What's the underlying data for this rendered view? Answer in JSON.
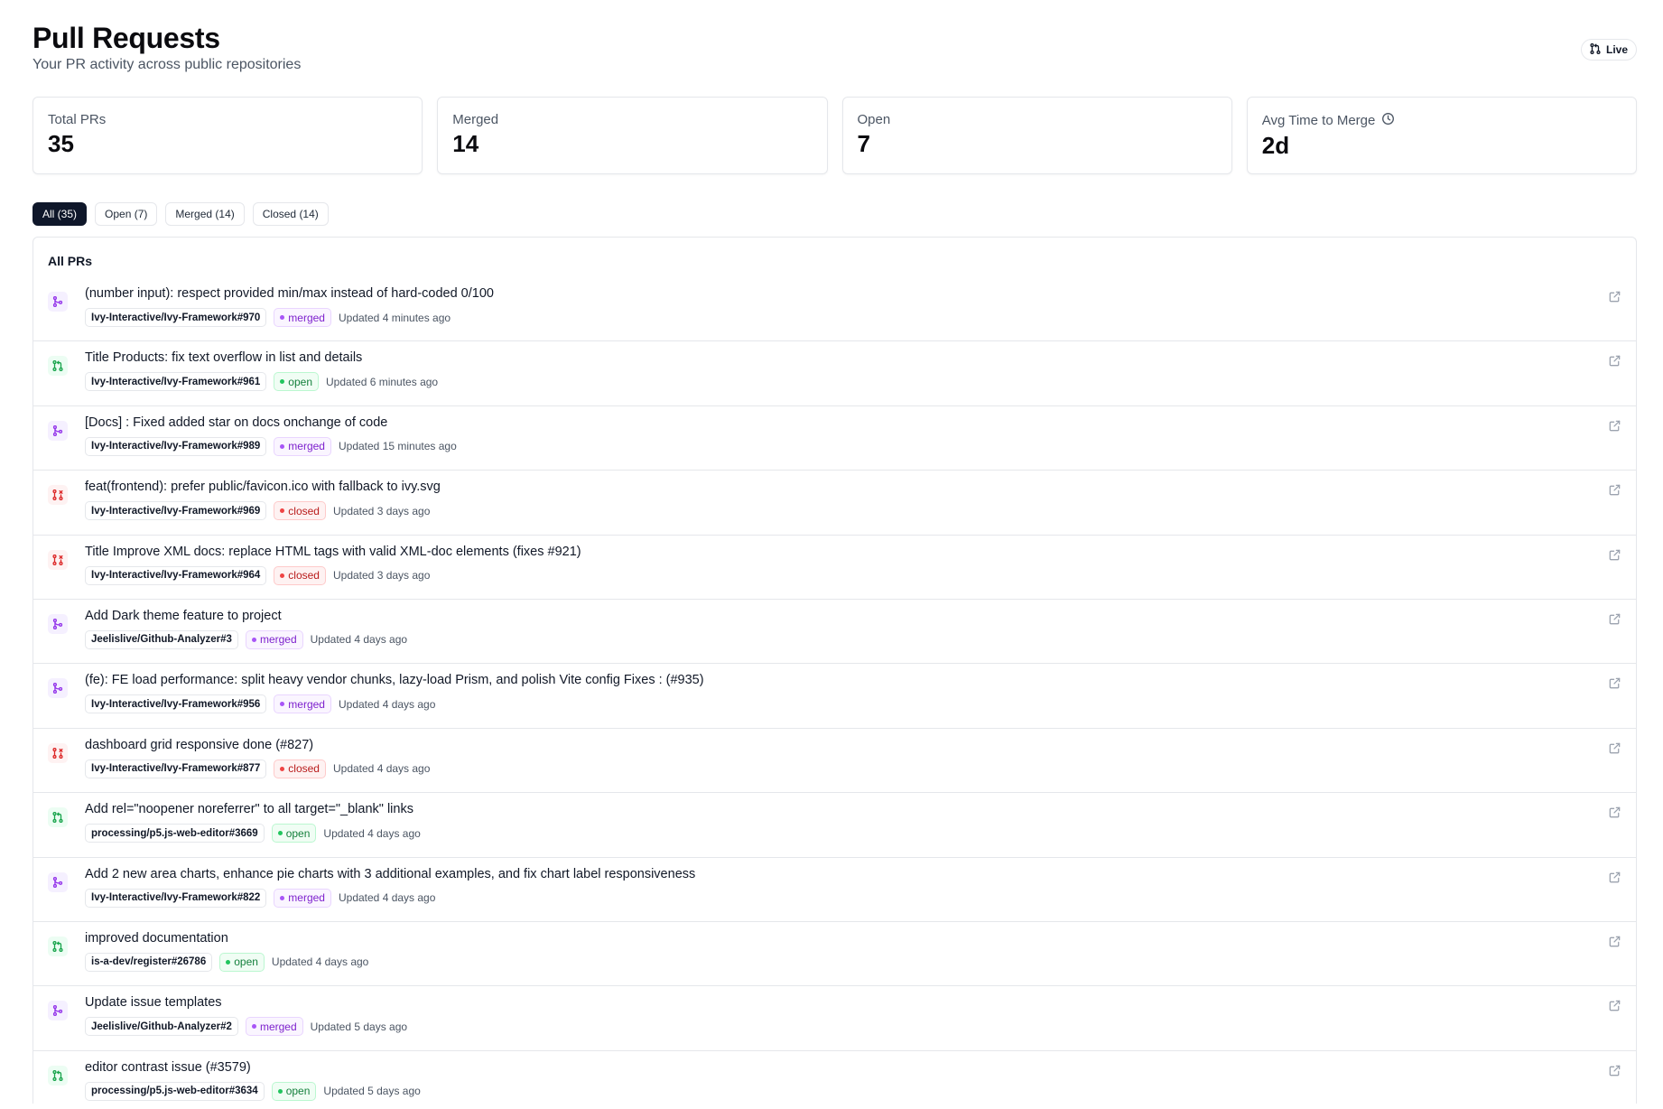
{
  "header": {
    "title": "Pull Requests",
    "subtitle": "Your PR activity across public repositories",
    "live_label": "Live"
  },
  "stats": [
    {
      "label": "Total PRs",
      "value": "35"
    },
    {
      "label": "Merged",
      "value": "14"
    },
    {
      "label": "Open",
      "value": "7"
    },
    {
      "label": "Avg Time to Merge",
      "value": "2d",
      "icon": "clock-icon"
    }
  ],
  "tabs": [
    {
      "label": "All (35)",
      "active": true
    },
    {
      "label": "Open (7)",
      "active": false
    },
    {
      "label": "Merged (14)",
      "active": false
    },
    {
      "label": "Closed (14)",
      "active": false
    }
  ],
  "list": {
    "title": "All PRs",
    "items": [
      {
        "title": "(number input): respect provided min/max instead of hard-coded 0/100",
        "repo": "Ivy-Interactive/Ivy-Framework#970",
        "status": "merged",
        "updated": "Updated 4 minutes ago"
      },
      {
        "title": "Title Products: fix text overflow in list and details",
        "repo": "Ivy-Interactive/Ivy-Framework#961",
        "status": "open",
        "updated": "Updated 6 minutes ago"
      },
      {
        "title": "[Docs] : Fixed added star on docs onchange of code",
        "repo": "Ivy-Interactive/Ivy-Framework#989",
        "status": "merged",
        "updated": "Updated 15 minutes ago"
      },
      {
        "title": "feat(frontend): prefer public/favicon.ico with fallback to ivy.svg",
        "repo": "Ivy-Interactive/Ivy-Framework#969",
        "status": "closed",
        "updated": "Updated 3 days ago"
      },
      {
        "title": "Title Improve XML docs: replace HTML tags with valid XML-doc elements (fixes #921)",
        "repo": "Ivy-Interactive/Ivy-Framework#964",
        "status": "closed",
        "updated": "Updated 3 days ago"
      },
      {
        "title": "Add Dark theme feature to project",
        "repo": "Jeelislive/Github-Analyzer#3",
        "status": "merged",
        "updated": "Updated 4 days ago"
      },
      {
        "title": "(fe): FE load performance: split heavy vendor chunks, lazy-load Prism, and polish Vite config Fixes : (#935)",
        "repo": "Ivy-Interactive/Ivy-Framework#956",
        "status": "merged",
        "updated": "Updated 4 days ago"
      },
      {
        "title": "dashboard grid responsive done (#827)",
        "repo": "Ivy-Interactive/Ivy-Framework#877",
        "status": "closed",
        "updated": "Updated 4 days ago"
      },
      {
        "title": "Add rel=\"noopener noreferrer\" to all target=\"_blank\" links",
        "repo": "processing/p5.js-web-editor#3669",
        "status": "open",
        "updated": "Updated 4 days ago"
      },
      {
        "title": "Add 2 new area charts, enhance pie charts with 3 additional examples, and fix chart label responsiveness",
        "repo": "Ivy-Interactive/Ivy-Framework#822",
        "status": "merged",
        "updated": "Updated 4 days ago"
      },
      {
        "title": "improved documentation",
        "repo": "is-a-dev/register#26786",
        "status": "open",
        "updated": "Updated 4 days ago"
      },
      {
        "title": "Update issue templates",
        "repo": "Jeelislive/Github-Analyzer#2",
        "status": "merged",
        "updated": "Updated 5 days ago"
      },
      {
        "title": "editor contrast issue (#3579)",
        "repo": "processing/p5.js-web-editor#3634",
        "status": "open",
        "updated": "Updated 5 days ago"
      }
    ]
  },
  "colors": {
    "merged": "#7e22ce",
    "open": "#15803d",
    "closed": "#b91c1c",
    "active_tab_bg": "#0f172a"
  }
}
